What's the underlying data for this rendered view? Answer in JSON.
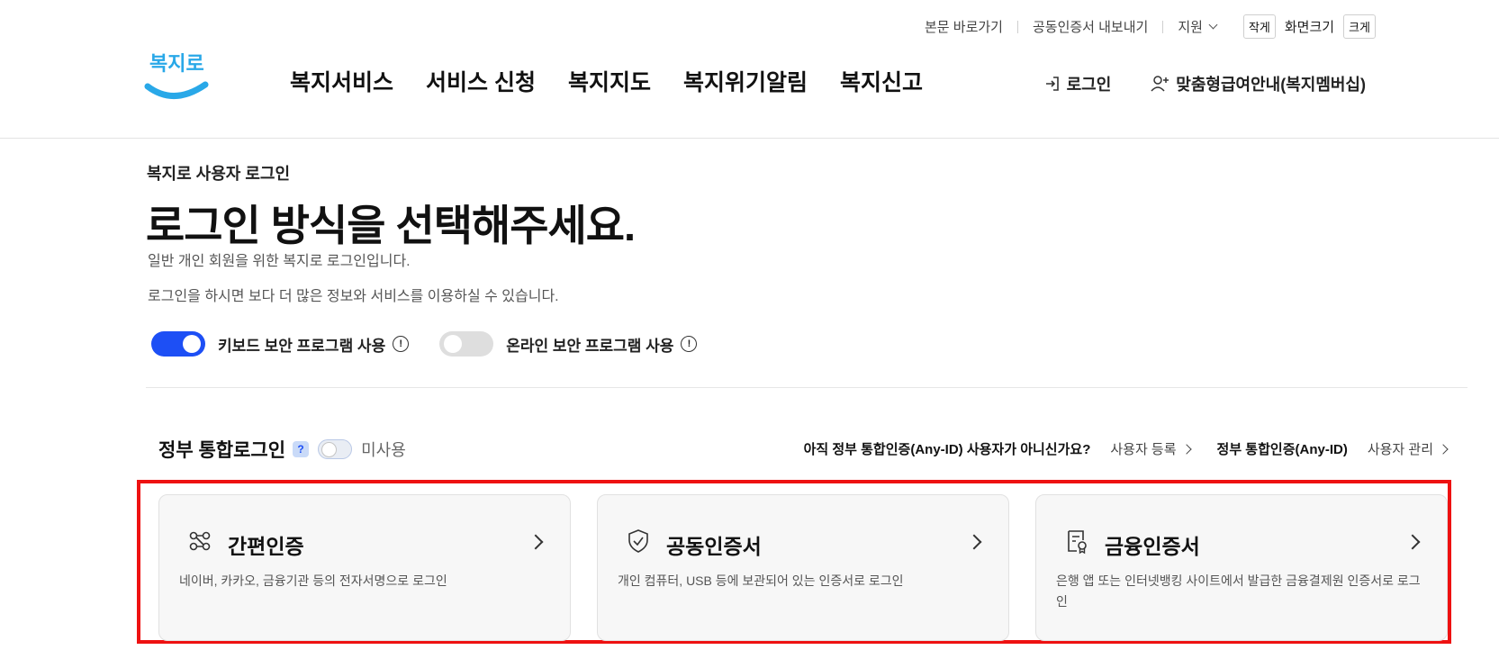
{
  "util_bar": {
    "skip_link": "본문 바로가기",
    "cert_export": "공동인증서 내보내기",
    "support": "지원",
    "font_small": "작게",
    "font_size_label": "화면크기",
    "font_large": "크게"
  },
  "logo_text": "복지로",
  "nav": {
    "items": [
      "복지서비스",
      "서비스 신청",
      "복지지도",
      "복지위기알림",
      "복지신고"
    ],
    "login": "로그인",
    "membership": "맞춤형급여안내(복지멤버십)"
  },
  "page": {
    "eyebrow": "복지로 사용자 로그인",
    "title": "로그인 방식을 선택해주세요.",
    "desc1": "일반 개인 회원을 위한 복지로 로그인입니다.",
    "desc2": "로그인을 하시면 보다 더 많은 정보와 서비스를 이용하실 수 있습니다."
  },
  "security": {
    "keyboard_label": "키보드 보안 프로그램 사용",
    "keyboard_on": true,
    "online_label": "온라인 보안 프로그램 사용",
    "online_on": false
  },
  "gov_login": {
    "title": "정부 통합로그인",
    "help": "?",
    "status": "미사용",
    "question": "아직 정부 통합인증(Any-ID) 사용자가 아니신가요?",
    "register": "사용자 등록",
    "anyid": "정부 통합인증(Any-ID)",
    "manage": "사용자 관리"
  },
  "cards": [
    {
      "title": "간편인증",
      "desc": "네이버, 카카오, 금융기관 등의 전자서명으로 로그인",
      "icon": "simple-auth-icon"
    },
    {
      "title": "공동인증서",
      "desc": "개인 컴퓨터, USB 등에 보관되어 있는 인증서로 로그인",
      "icon": "shield-check-icon"
    },
    {
      "title": "금융인증서",
      "desc": "은행 앱 또는 인터넷뱅킹 사이트에서 발급한 금융결제원 인증서로 로그인",
      "icon": "certificate-icon"
    }
  ],
  "colors": {
    "accent": "#1d4ff5",
    "logo_blue": "#29a8e8",
    "highlight": "#ee1111"
  }
}
